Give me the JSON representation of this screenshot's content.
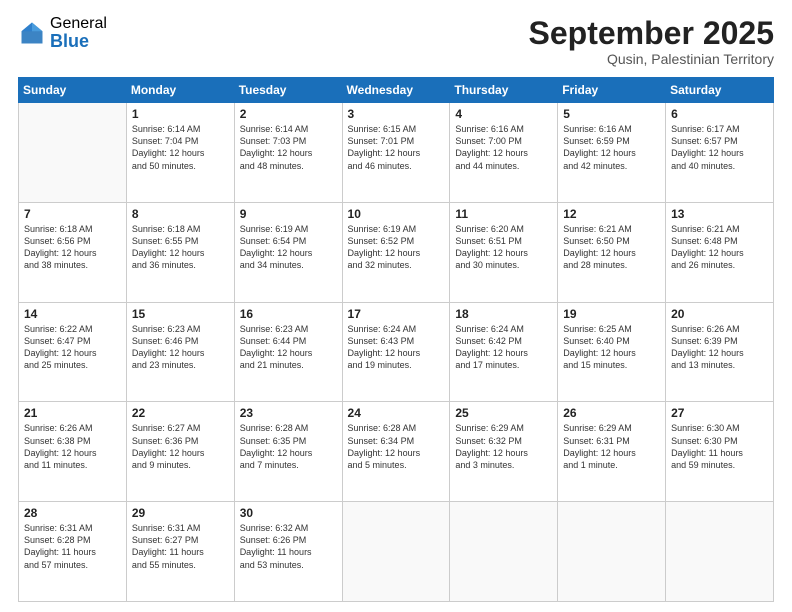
{
  "logo": {
    "general": "General",
    "blue": "Blue"
  },
  "header": {
    "title": "September 2025",
    "subtitle": "Qusin, Palestinian Territory"
  },
  "days_of_week": [
    "Sunday",
    "Monday",
    "Tuesday",
    "Wednesday",
    "Thursday",
    "Friday",
    "Saturday"
  ],
  "weeks": [
    [
      {
        "day": "",
        "info": ""
      },
      {
        "day": "1",
        "info": "Sunrise: 6:14 AM\nSunset: 7:04 PM\nDaylight: 12 hours\nand 50 minutes."
      },
      {
        "day": "2",
        "info": "Sunrise: 6:14 AM\nSunset: 7:03 PM\nDaylight: 12 hours\nand 48 minutes."
      },
      {
        "day": "3",
        "info": "Sunrise: 6:15 AM\nSunset: 7:01 PM\nDaylight: 12 hours\nand 46 minutes."
      },
      {
        "day": "4",
        "info": "Sunrise: 6:16 AM\nSunset: 7:00 PM\nDaylight: 12 hours\nand 44 minutes."
      },
      {
        "day": "5",
        "info": "Sunrise: 6:16 AM\nSunset: 6:59 PM\nDaylight: 12 hours\nand 42 minutes."
      },
      {
        "day": "6",
        "info": "Sunrise: 6:17 AM\nSunset: 6:57 PM\nDaylight: 12 hours\nand 40 minutes."
      }
    ],
    [
      {
        "day": "7",
        "info": "Sunrise: 6:18 AM\nSunset: 6:56 PM\nDaylight: 12 hours\nand 38 minutes."
      },
      {
        "day": "8",
        "info": "Sunrise: 6:18 AM\nSunset: 6:55 PM\nDaylight: 12 hours\nand 36 minutes."
      },
      {
        "day": "9",
        "info": "Sunrise: 6:19 AM\nSunset: 6:54 PM\nDaylight: 12 hours\nand 34 minutes."
      },
      {
        "day": "10",
        "info": "Sunrise: 6:19 AM\nSunset: 6:52 PM\nDaylight: 12 hours\nand 32 minutes."
      },
      {
        "day": "11",
        "info": "Sunrise: 6:20 AM\nSunset: 6:51 PM\nDaylight: 12 hours\nand 30 minutes."
      },
      {
        "day": "12",
        "info": "Sunrise: 6:21 AM\nSunset: 6:50 PM\nDaylight: 12 hours\nand 28 minutes."
      },
      {
        "day": "13",
        "info": "Sunrise: 6:21 AM\nSunset: 6:48 PM\nDaylight: 12 hours\nand 26 minutes."
      }
    ],
    [
      {
        "day": "14",
        "info": "Sunrise: 6:22 AM\nSunset: 6:47 PM\nDaylight: 12 hours\nand 25 minutes."
      },
      {
        "day": "15",
        "info": "Sunrise: 6:23 AM\nSunset: 6:46 PM\nDaylight: 12 hours\nand 23 minutes."
      },
      {
        "day": "16",
        "info": "Sunrise: 6:23 AM\nSunset: 6:44 PM\nDaylight: 12 hours\nand 21 minutes."
      },
      {
        "day": "17",
        "info": "Sunrise: 6:24 AM\nSunset: 6:43 PM\nDaylight: 12 hours\nand 19 minutes."
      },
      {
        "day": "18",
        "info": "Sunrise: 6:24 AM\nSunset: 6:42 PM\nDaylight: 12 hours\nand 17 minutes."
      },
      {
        "day": "19",
        "info": "Sunrise: 6:25 AM\nSunset: 6:40 PM\nDaylight: 12 hours\nand 15 minutes."
      },
      {
        "day": "20",
        "info": "Sunrise: 6:26 AM\nSunset: 6:39 PM\nDaylight: 12 hours\nand 13 minutes."
      }
    ],
    [
      {
        "day": "21",
        "info": "Sunrise: 6:26 AM\nSunset: 6:38 PM\nDaylight: 12 hours\nand 11 minutes."
      },
      {
        "day": "22",
        "info": "Sunrise: 6:27 AM\nSunset: 6:36 PM\nDaylight: 12 hours\nand 9 minutes."
      },
      {
        "day": "23",
        "info": "Sunrise: 6:28 AM\nSunset: 6:35 PM\nDaylight: 12 hours\nand 7 minutes."
      },
      {
        "day": "24",
        "info": "Sunrise: 6:28 AM\nSunset: 6:34 PM\nDaylight: 12 hours\nand 5 minutes."
      },
      {
        "day": "25",
        "info": "Sunrise: 6:29 AM\nSunset: 6:32 PM\nDaylight: 12 hours\nand 3 minutes."
      },
      {
        "day": "26",
        "info": "Sunrise: 6:29 AM\nSunset: 6:31 PM\nDaylight: 12 hours\nand 1 minute."
      },
      {
        "day": "27",
        "info": "Sunrise: 6:30 AM\nSunset: 6:30 PM\nDaylight: 11 hours\nand 59 minutes."
      }
    ],
    [
      {
        "day": "28",
        "info": "Sunrise: 6:31 AM\nSunset: 6:28 PM\nDaylight: 11 hours\nand 57 minutes."
      },
      {
        "day": "29",
        "info": "Sunrise: 6:31 AM\nSunset: 6:27 PM\nDaylight: 11 hours\nand 55 minutes."
      },
      {
        "day": "30",
        "info": "Sunrise: 6:32 AM\nSunset: 6:26 PM\nDaylight: 11 hours\nand 53 minutes."
      },
      {
        "day": "",
        "info": ""
      },
      {
        "day": "",
        "info": ""
      },
      {
        "day": "",
        "info": ""
      },
      {
        "day": "",
        "info": ""
      }
    ]
  ]
}
